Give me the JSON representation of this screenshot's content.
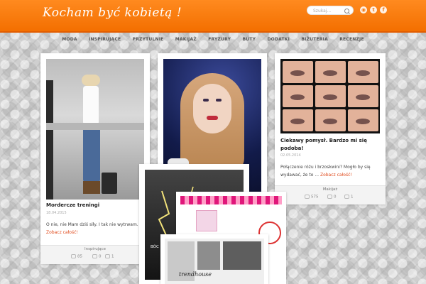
{
  "header": {
    "logo": "Kocham być kobietą !",
    "search_placeholder": "Szukaj...",
    "social": [
      "rss",
      "twitter",
      "google-plus"
    ]
  },
  "nav": [
    "MODA",
    "INSPIRUJĄCE",
    "PRZYTULNIE",
    "MAKIJAŻ",
    "FRYZURY",
    "BUTY",
    "DODATKI",
    "BIŻUTERIA",
    "RECENZJE"
  ],
  "posts": [
    {
      "title": "Mordercze treningi",
      "date": "18.04.2015",
      "excerpt": "O nie, nie Mam dziś siły. I tak nie wytrwam.",
      "more": "Zobacz całość!",
      "category": "Inspirujące",
      "views": "85",
      "comments": "0",
      "likes": "1"
    },
    {
      "title": "Ciekawy pomysł. Bardzo mi się podoba!",
      "date": "02.05.2014",
      "excerpt": "Połączenie różu i brzoskwini? Mogło by się wydawać, że to ...",
      "more": "Zobacz całość!",
      "category": "Makijaż",
      "views": "575",
      "comments": "0",
      "likes": "1"
    }
  ],
  "overlay": {
    "snippet": "BÓC",
    "trendhouse": "trendhouse"
  }
}
